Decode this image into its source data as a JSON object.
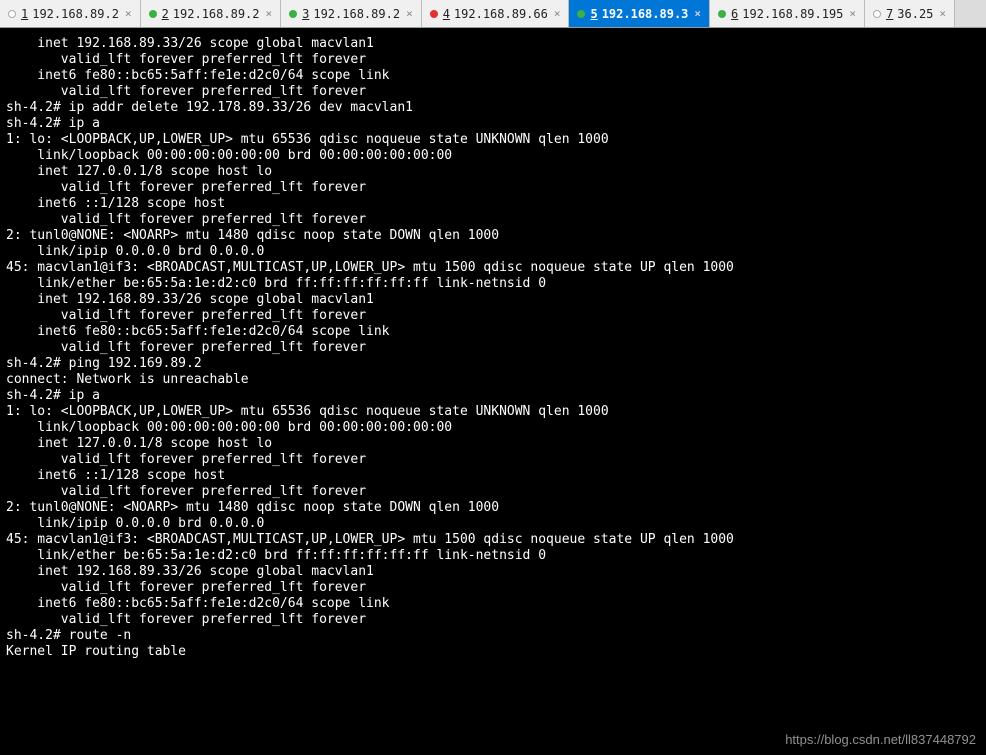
{
  "tabs": [
    {
      "num": "1",
      "label": "192.168.89.2",
      "dot": "white",
      "active": false
    },
    {
      "num": "2",
      "label": "192.168.89.2",
      "dot": "green",
      "active": false
    },
    {
      "num": "3",
      "label": "192.168.89.2",
      "dot": "green",
      "active": false
    },
    {
      "num": "4",
      "label": "192.168.89.66",
      "dot": "red",
      "active": false
    },
    {
      "num": "5",
      "label": "192.168.89.3",
      "dot": "green",
      "active": true
    },
    {
      "num": "6",
      "label": "192.168.89.195",
      "dot": "green",
      "active": false
    },
    {
      "num": "7",
      "label": "36.25",
      "dot": "white",
      "active": false
    }
  ],
  "terminal_lines": [
    "    inet 192.168.89.33/26 scope global macvlan1",
    "       valid_lft forever preferred_lft forever",
    "    inet6 fe80::bc65:5aff:fe1e:d2c0/64 scope link",
    "       valid_lft forever preferred_lft forever",
    "sh-4.2# ip addr delete 192.178.89.33/26 dev macvlan1",
    "sh-4.2# ip a",
    "1: lo: <LOOPBACK,UP,LOWER_UP> mtu 65536 qdisc noqueue state UNKNOWN qlen 1000",
    "    link/loopback 00:00:00:00:00:00 brd 00:00:00:00:00:00",
    "    inet 127.0.0.1/8 scope host lo",
    "       valid_lft forever preferred_lft forever",
    "    inet6 ::1/128 scope host",
    "       valid_lft forever preferred_lft forever",
    "2: tunl0@NONE: <NOARP> mtu 1480 qdisc noop state DOWN qlen 1000",
    "    link/ipip 0.0.0.0 brd 0.0.0.0",
    "45: macvlan1@if3: <BROADCAST,MULTICAST,UP,LOWER_UP> mtu 1500 qdisc noqueue state UP qlen 1000",
    "    link/ether be:65:5a:1e:d2:c0 brd ff:ff:ff:ff:ff:ff link-netnsid 0",
    "    inet 192.168.89.33/26 scope global macvlan1",
    "       valid_lft forever preferred_lft forever",
    "    inet6 fe80::bc65:5aff:fe1e:d2c0/64 scope link",
    "       valid_lft forever preferred_lft forever",
    "sh-4.2# ping 192.169.89.2",
    "connect: Network is unreachable",
    "sh-4.2# ip a",
    "1: lo: <LOOPBACK,UP,LOWER_UP> mtu 65536 qdisc noqueue state UNKNOWN qlen 1000",
    "    link/loopback 00:00:00:00:00:00 brd 00:00:00:00:00:00",
    "    inet 127.0.0.1/8 scope host lo",
    "       valid_lft forever preferred_lft forever",
    "    inet6 ::1/128 scope host",
    "       valid_lft forever preferred_lft forever",
    "2: tunl0@NONE: <NOARP> mtu 1480 qdisc noop state DOWN qlen 1000",
    "    link/ipip 0.0.0.0 brd 0.0.0.0",
    "45: macvlan1@if3: <BROADCAST,MULTICAST,UP,LOWER_UP> mtu 1500 qdisc noqueue state UP qlen 1000",
    "    link/ether be:65:5a:1e:d2:c0 brd ff:ff:ff:ff:ff:ff link-netnsid 0",
    "    inet 192.168.89.33/26 scope global macvlan1",
    "       valid_lft forever preferred_lft forever",
    "    inet6 fe80::bc65:5aff:fe1e:d2c0/64 scope link",
    "       valid_lft forever preferred_lft forever",
    "sh-4.2# route -n",
    "Kernel IP routing table"
  ],
  "watermark": "https://blog.csdn.net/ll837448792"
}
